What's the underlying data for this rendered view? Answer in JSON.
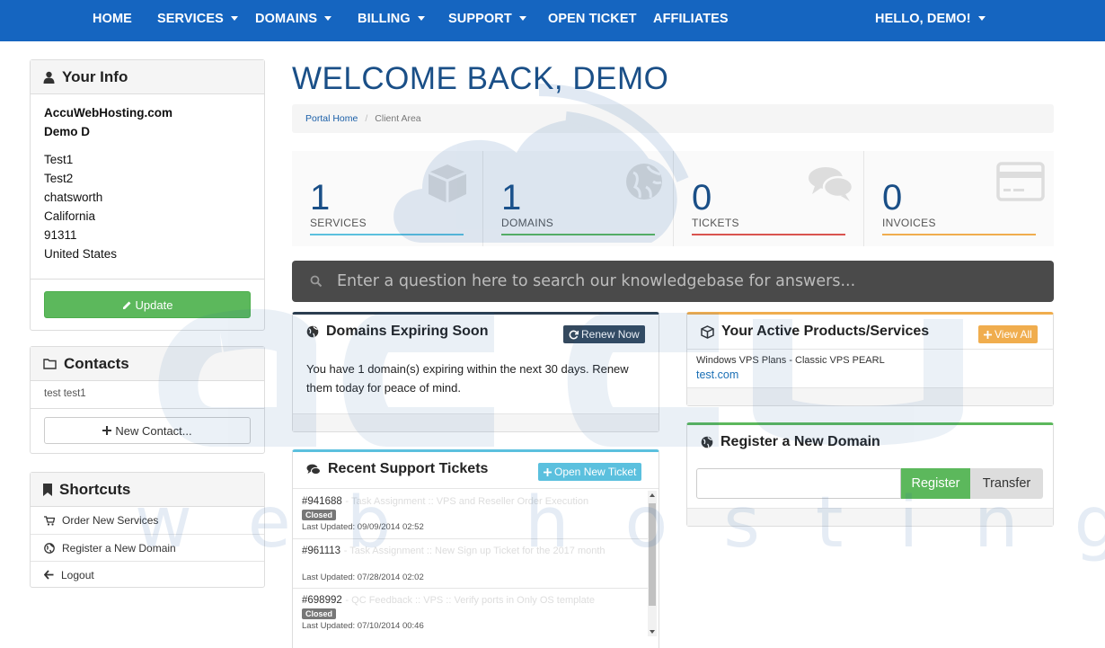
{
  "nav": {
    "items": [
      {
        "label": "HOME",
        "dropdown": false
      },
      {
        "label": "SERVICES",
        "dropdown": true
      },
      {
        "label": "DOMAINS",
        "dropdown": true
      },
      {
        "label": "BILLING",
        "dropdown": true
      },
      {
        "label": "SUPPORT",
        "dropdown": true
      },
      {
        "label": "OPEN TICKET",
        "dropdown": false
      },
      {
        "label": "AFFILIATES",
        "dropdown": false
      }
    ],
    "user": "HELLO, DEMO!"
  },
  "your_info": {
    "title": "Your Info",
    "company": "AccuWebHosting.com",
    "name": "Demo D",
    "address": [
      "Test1",
      "Test2",
      "chatsworth",
      "California",
      "91311",
      "United States"
    ],
    "update_label": "Update"
  },
  "contacts": {
    "title": "Contacts",
    "items": [
      "test test1"
    ],
    "new_label": "New Contact..."
  },
  "shortcuts": {
    "title": "Shortcuts",
    "items": [
      {
        "label": "Order New Services",
        "icon": "cart-icon"
      },
      {
        "label": "Register a New Domain",
        "icon": "globe-icon"
      },
      {
        "label": "Logout",
        "icon": "arrow-left-icon"
      }
    ]
  },
  "main": {
    "title": "WELCOME BACK, DEMO",
    "breadcrumb": {
      "home": "Portal Home",
      "current": "Client Area"
    }
  },
  "stats": [
    {
      "value": "1",
      "label": "SERVICES",
      "color": "#5bc0de",
      "icon": "cube-icon"
    },
    {
      "value": "1",
      "label": "DOMAINS",
      "color": "#5cb85c",
      "icon": "globe-icon"
    },
    {
      "value": "0",
      "label": "TICKETS",
      "color": "#d9534f",
      "icon": "comments-icon"
    },
    {
      "value": "0",
      "label": "INVOICES",
      "color": "#f0ad4e",
      "icon": "credit-card-icon"
    }
  ],
  "kb": {
    "placeholder": "Enter a question here to search our knowledgebase for answers..."
  },
  "domains_expiring": {
    "title": "Domains Expiring Soon",
    "button": "Renew Now",
    "text": "You have 1 domain(s) expiring within the next 30 days. Renew them today for peace of mind."
  },
  "products": {
    "title": "Your Active Products/Services",
    "button": "View All",
    "item_name": "Windows VPS Plans - Classic VPS PEARL",
    "item_domain": "test.com"
  },
  "tickets": {
    "title": "Recent Support Tickets",
    "button": "Open New Ticket",
    "items": [
      {
        "id": "#941688",
        "subject": "Task Assignment :: VPS and Reseller Order Execution",
        "status": "Closed",
        "updated": "Last Updated: 09/09/2014 02:52"
      },
      {
        "id": "#961113",
        "subject": "Task Assignment :: New Sign up Ticket for the 2017 month",
        "status": "",
        "updated": "Last Updated: 07/28/2014 02:02"
      },
      {
        "id": "#698992",
        "subject": "QC Feedback :: VPS :: Verify ports in Only OS template",
        "status": "Closed",
        "updated": "Last Updated: 07/10/2014 00:46"
      }
    ]
  },
  "register_domain": {
    "title": "Register a New Domain",
    "register": "Register",
    "transfer": "Transfer"
  },
  "watermark": {
    "brand": "accu",
    "tagline": "web hosting"
  }
}
